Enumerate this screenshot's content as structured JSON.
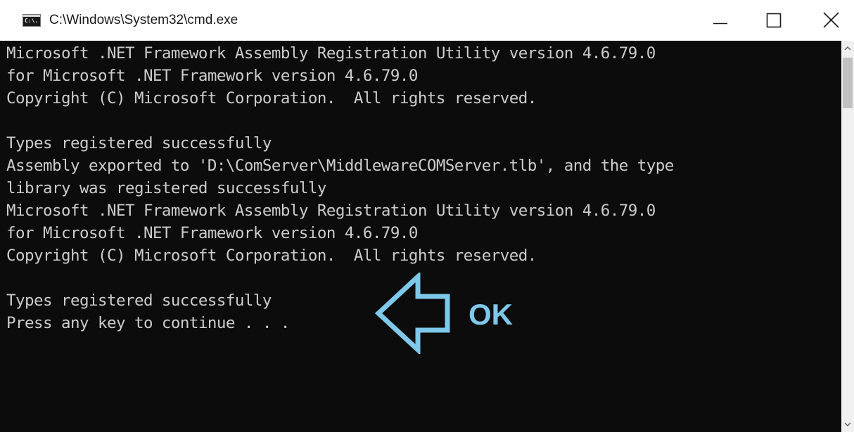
{
  "window": {
    "title": "C:\\Windows\\System32\\cmd.exe",
    "icon_label": "C:\\.",
    "icon": "cmd-icon",
    "controls": {
      "minimize_icon": "minimize-icon",
      "maximize_icon": "maximize-icon",
      "close_icon": "close-icon"
    }
  },
  "console": {
    "background": "#0c0c0c",
    "text_color": "#cccccc",
    "lines": [
      "Microsoft .NET Framework Assembly Registration Utility version 4.6.79.0",
      "for Microsoft .NET Framework version 4.6.79.0",
      "Copyright (C) Microsoft Corporation.  All rights reserved.",
      "",
      "Types registered successfully",
      "Assembly exported to 'D:\\ComServer\\MiddlewareCOMServer.tlb', and the type",
      "library was registered successfully",
      "Microsoft .NET Framework Assembly Registration Utility version 4.6.79.0",
      "for Microsoft .NET Framework version 4.6.79.0",
      "Copyright (C) Microsoft Corporation.  All rights reserved.",
      "",
      "Types registered successfully",
      "Press any key to continue . . ."
    ]
  },
  "annotation": {
    "label": "OK",
    "color": "#7ec8ea",
    "icon": "left-arrow-icon"
  },
  "scrollbar": {
    "up_icon": "scroll-up-icon",
    "down_icon": "scroll-down-icon"
  }
}
